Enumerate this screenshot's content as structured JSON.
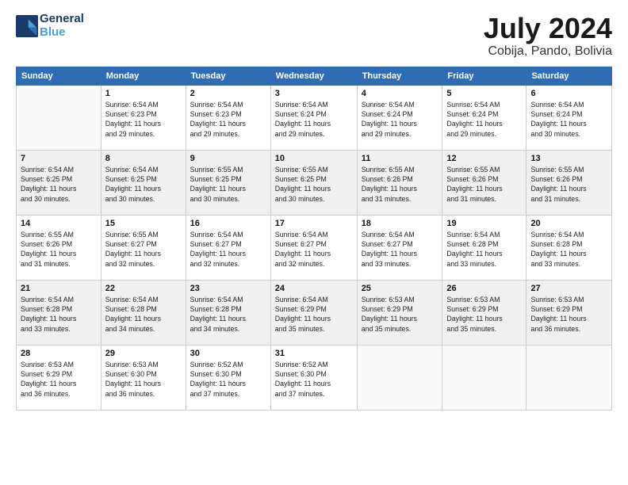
{
  "header": {
    "logo_line1": "General",
    "logo_line2": "Blue",
    "month_title": "July 2024",
    "subtitle": "Cobija, Pando, Bolivia"
  },
  "days_of_week": [
    "Sunday",
    "Monday",
    "Tuesday",
    "Wednesday",
    "Thursday",
    "Friday",
    "Saturday"
  ],
  "weeks": [
    [
      {
        "day": "",
        "info": ""
      },
      {
        "day": "1",
        "info": "Sunrise: 6:54 AM\nSunset: 6:23 PM\nDaylight: 11 hours\nand 29 minutes."
      },
      {
        "day": "2",
        "info": "Sunrise: 6:54 AM\nSunset: 6:23 PM\nDaylight: 11 hours\nand 29 minutes."
      },
      {
        "day": "3",
        "info": "Sunrise: 6:54 AM\nSunset: 6:24 PM\nDaylight: 11 hours\nand 29 minutes."
      },
      {
        "day": "4",
        "info": "Sunrise: 6:54 AM\nSunset: 6:24 PM\nDaylight: 11 hours\nand 29 minutes."
      },
      {
        "day": "5",
        "info": "Sunrise: 6:54 AM\nSunset: 6:24 PM\nDaylight: 11 hours\nand 29 minutes."
      },
      {
        "day": "6",
        "info": "Sunrise: 6:54 AM\nSunset: 6:24 PM\nDaylight: 11 hours\nand 30 minutes."
      }
    ],
    [
      {
        "day": "7",
        "info": "Sunrise: 6:54 AM\nSunset: 6:25 PM\nDaylight: 11 hours\nand 30 minutes."
      },
      {
        "day": "8",
        "info": "Sunrise: 6:54 AM\nSunset: 6:25 PM\nDaylight: 11 hours\nand 30 minutes."
      },
      {
        "day": "9",
        "info": "Sunrise: 6:55 AM\nSunset: 6:25 PM\nDaylight: 11 hours\nand 30 minutes."
      },
      {
        "day": "10",
        "info": "Sunrise: 6:55 AM\nSunset: 6:25 PM\nDaylight: 11 hours\nand 30 minutes."
      },
      {
        "day": "11",
        "info": "Sunrise: 6:55 AM\nSunset: 6:26 PM\nDaylight: 11 hours\nand 31 minutes."
      },
      {
        "day": "12",
        "info": "Sunrise: 6:55 AM\nSunset: 6:26 PM\nDaylight: 11 hours\nand 31 minutes."
      },
      {
        "day": "13",
        "info": "Sunrise: 6:55 AM\nSunset: 6:26 PM\nDaylight: 11 hours\nand 31 minutes."
      }
    ],
    [
      {
        "day": "14",
        "info": "Sunrise: 6:55 AM\nSunset: 6:26 PM\nDaylight: 11 hours\nand 31 minutes."
      },
      {
        "day": "15",
        "info": "Sunrise: 6:55 AM\nSunset: 6:27 PM\nDaylight: 11 hours\nand 32 minutes."
      },
      {
        "day": "16",
        "info": "Sunrise: 6:54 AM\nSunset: 6:27 PM\nDaylight: 11 hours\nand 32 minutes."
      },
      {
        "day": "17",
        "info": "Sunrise: 6:54 AM\nSunset: 6:27 PM\nDaylight: 11 hours\nand 32 minutes."
      },
      {
        "day": "18",
        "info": "Sunrise: 6:54 AM\nSunset: 6:27 PM\nDaylight: 11 hours\nand 33 minutes."
      },
      {
        "day": "19",
        "info": "Sunrise: 6:54 AM\nSunset: 6:28 PM\nDaylight: 11 hours\nand 33 minutes."
      },
      {
        "day": "20",
        "info": "Sunrise: 6:54 AM\nSunset: 6:28 PM\nDaylight: 11 hours\nand 33 minutes."
      }
    ],
    [
      {
        "day": "21",
        "info": "Sunrise: 6:54 AM\nSunset: 6:28 PM\nDaylight: 11 hours\nand 33 minutes."
      },
      {
        "day": "22",
        "info": "Sunrise: 6:54 AM\nSunset: 6:28 PM\nDaylight: 11 hours\nand 34 minutes."
      },
      {
        "day": "23",
        "info": "Sunrise: 6:54 AM\nSunset: 6:28 PM\nDaylight: 11 hours\nand 34 minutes."
      },
      {
        "day": "24",
        "info": "Sunrise: 6:54 AM\nSunset: 6:29 PM\nDaylight: 11 hours\nand 35 minutes."
      },
      {
        "day": "25",
        "info": "Sunrise: 6:53 AM\nSunset: 6:29 PM\nDaylight: 11 hours\nand 35 minutes."
      },
      {
        "day": "26",
        "info": "Sunrise: 6:53 AM\nSunset: 6:29 PM\nDaylight: 11 hours\nand 35 minutes."
      },
      {
        "day": "27",
        "info": "Sunrise: 6:53 AM\nSunset: 6:29 PM\nDaylight: 11 hours\nand 36 minutes."
      }
    ],
    [
      {
        "day": "28",
        "info": "Sunrise: 6:53 AM\nSunset: 6:29 PM\nDaylight: 11 hours\nand 36 minutes."
      },
      {
        "day": "29",
        "info": "Sunrise: 6:53 AM\nSunset: 6:30 PM\nDaylight: 11 hours\nand 36 minutes."
      },
      {
        "day": "30",
        "info": "Sunrise: 6:52 AM\nSunset: 6:30 PM\nDaylight: 11 hours\nand 37 minutes."
      },
      {
        "day": "31",
        "info": "Sunrise: 6:52 AM\nSunset: 6:30 PM\nDaylight: 11 hours\nand 37 minutes."
      },
      {
        "day": "",
        "info": ""
      },
      {
        "day": "",
        "info": ""
      },
      {
        "day": "",
        "info": ""
      }
    ]
  ]
}
